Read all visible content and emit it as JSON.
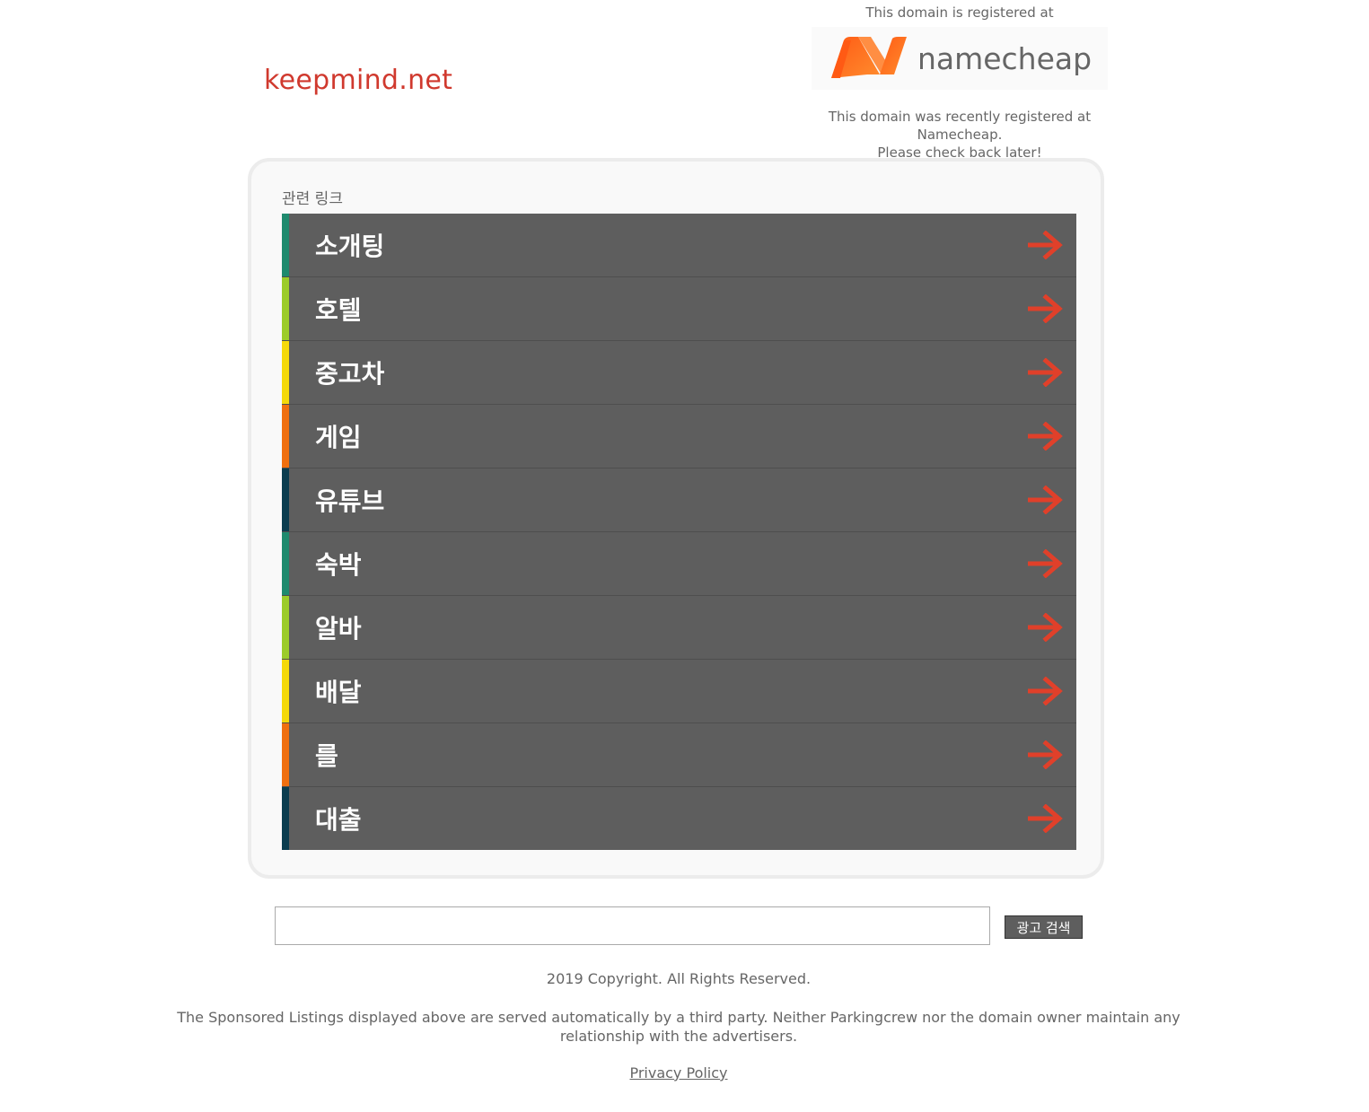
{
  "header": {
    "domain": "keepmind.net"
  },
  "registrar": {
    "top_text": "This domain is registered at",
    "logo_word": "namecheap",
    "message_line1": "This domain was recently registered at Namecheap.",
    "message_line2": "Please check back later!",
    "logo_colors": [
      "#ff5a14",
      "#ff8c2e"
    ]
  },
  "related": {
    "heading": "관련 링크",
    "arrow_color": "#e0402a",
    "row_bg": "#5e5e5e",
    "items": [
      {
        "label": "소개팅",
        "color": "#1f8a6e"
      },
      {
        "label": "호텔",
        "color": "#9ccc2a"
      },
      {
        "label": "중고차",
        "color": "#f5d90a"
      },
      {
        "label": "게임",
        "color": "#f07010"
      },
      {
        "label": "유튜브",
        "color": "#0b3d4f"
      },
      {
        "label": "숙박",
        "color": "#1f8a6e"
      },
      {
        "label": "알바",
        "color": "#9ccc2a"
      },
      {
        "label": "배달",
        "color": "#f5d90a"
      },
      {
        "label": "를",
        "color": "#f07010"
      },
      {
        "label": "대출",
        "color": "#0b3d4f"
      }
    ]
  },
  "search": {
    "value": "",
    "button_label": "광고 검색"
  },
  "footer": {
    "copyright": "2019 Copyright. All Rights Reserved.",
    "disclaimer": "The Sponsored Listings displayed above are served automatically by a third party. Neither Parkingcrew nor the domain owner maintain any relationship with the advertisers.",
    "privacy_label": "Privacy Policy"
  }
}
